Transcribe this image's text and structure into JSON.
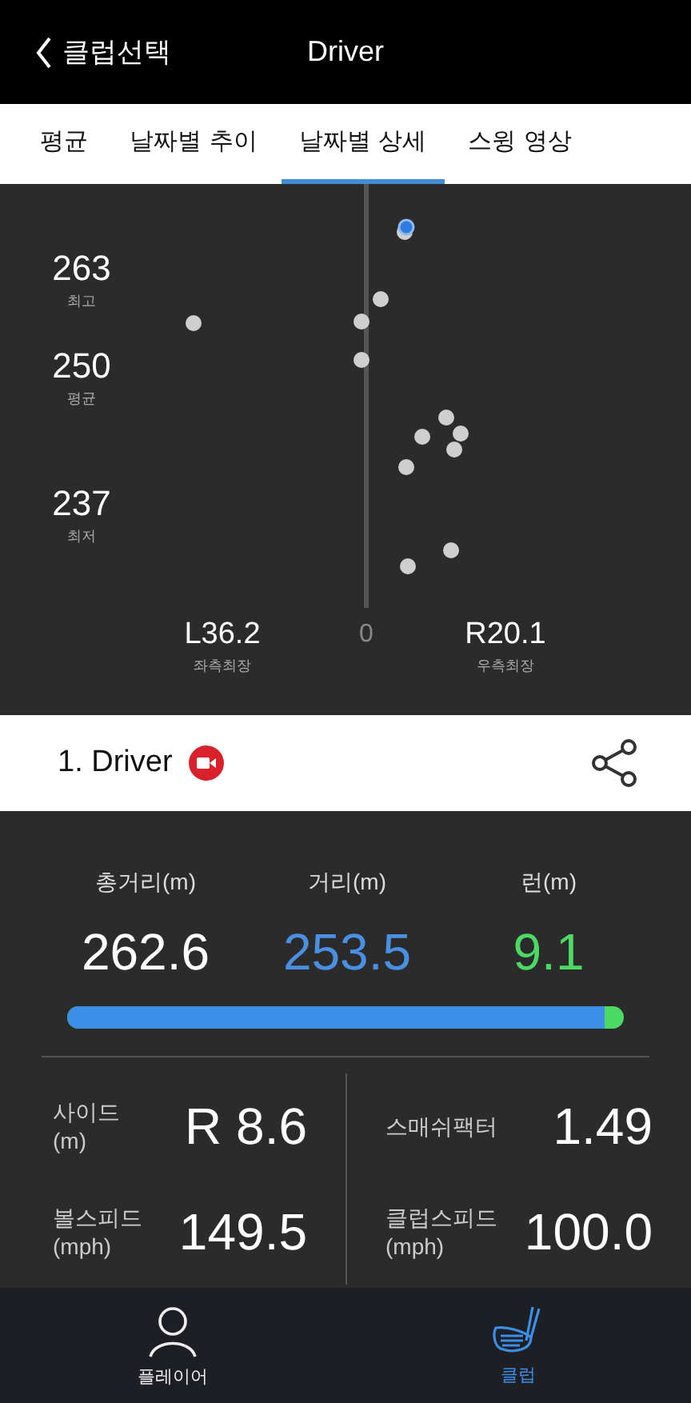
{
  "header": {
    "back_label": "클럽선택",
    "title": "Driver"
  },
  "tabs": [
    {
      "label": "평균",
      "selected": false
    },
    {
      "label": "날짜별 추이",
      "selected": false
    },
    {
      "label": "날짜별 상세",
      "selected": true
    },
    {
      "label": "스윙 영상",
      "selected": false
    }
  ],
  "dispersion": {
    "distance_labels": [
      {
        "value": "263",
        "caption": "최고"
      },
      {
        "value": "250",
        "caption": "평균"
      },
      {
        "value": "237",
        "caption": "최저"
      }
    ],
    "left": {
      "value": "L36.2",
      "caption": "좌측최장"
    },
    "center": "0",
    "right": {
      "value": "R20.1",
      "caption": "우측최장"
    }
  },
  "club": {
    "name": "1. Driver",
    "video": true
  },
  "distance": {
    "columns": [
      {
        "label": "총거리(m)",
        "value": "262.6",
        "kind": "total"
      },
      {
        "label": "거리(m)",
        "value": "253.5",
        "kind": "carry"
      },
      {
        "label": "런(m)",
        "value": "9.1",
        "kind": "run"
      }
    ],
    "level": 0.965
  },
  "metrics": [
    {
      "label": "사이드",
      "unit": "(m)",
      "value": "R 8.6"
    },
    {
      "label": "스매쉬팩터",
      "value": "1.49"
    },
    {
      "label": "볼스피드",
      "unit": "(mph)",
      "value": "149.5"
    },
    {
      "label": "클럽스피드",
      "unit": "(mph)",
      "value": "100.0"
    }
  ],
  "bottom_nav": [
    {
      "label": "플레이어",
      "kind": "player",
      "selected": false
    },
    {
      "label": "클럽",
      "kind": "club",
      "selected": true
    }
  ]
}
